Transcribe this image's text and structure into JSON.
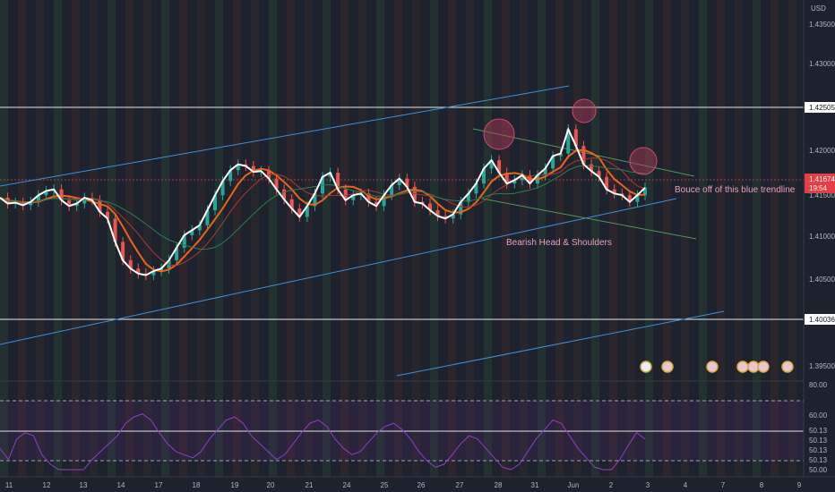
{
  "chart_data": {
    "type": "candlestick",
    "currency": "USD",
    "y_ticks": [
      "1.43500",
      "1.43000",
      "1.42000",
      "1.41500",
      "1.41000",
      "1.40500",
      "1.39500"
    ],
    "ylim": [
      1.395,
      1.436
    ],
    "x_ticks": [
      "11",
      "12",
      "13",
      "14",
      "17",
      "18",
      "19",
      "20",
      "21",
      "24",
      "25",
      "26",
      "27",
      "28",
      "31",
      "Jun",
      "2",
      "3",
      "4",
      "7",
      "8",
      "9"
    ],
    "price_labels": {
      "upper_level": "1.42505",
      "lower_level": "1.40036",
      "current_price": "1.41674",
      "countdown": "19:54"
    },
    "annotations": {
      "trendline_note": "Bouce off of this blue trendline",
      "pattern_note": "Bearish Head & Shoulders"
    },
    "close_path": [
      1.4155,
      1.4148,
      1.4149,
      1.4146,
      1.415,
      1.4158,
      1.4163,
      1.4165,
      1.4152,
      1.4145,
      1.4148,
      1.4155,
      1.4152,
      1.4138,
      1.413,
      1.4102,
      1.408,
      1.407,
      1.4064,
      1.4062,
      1.4067,
      1.407,
      1.408,
      1.4095,
      1.411,
      1.4116,
      1.4122,
      1.414,
      1.4158,
      1.4175,
      1.4188,
      1.4195,
      1.4193,
      1.4186,
      1.4187,
      1.4178,
      1.4165,
      1.4153,
      1.4142,
      1.4132,
      1.4145,
      1.416,
      1.418,
      1.4185,
      1.4165,
      1.4152,
      1.4158,
      1.416,
      1.415,
      1.4145,
      1.4158,
      1.417,
      1.4178,
      1.4168,
      1.415,
      1.4148,
      1.414,
      1.4133,
      1.413,
      1.4135,
      1.415,
      1.416,
      1.4172,
      1.419,
      1.42,
      1.4185,
      1.4172,
      1.4176,
      1.4182,
      1.4172,
      1.4182,
      1.419,
      1.4205,
      1.4208,
      1.4237,
      1.4217,
      1.4195,
      1.4187,
      1.418,
      1.4165,
      1.416,
      1.4158,
      1.415,
      1.4158,
      1.4167
    ],
    "rsi": {
      "levels": [
        "80.00",
        "60.00",
        "50.13",
        "50.13",
        "50.13",
        "50.13",
        "50.00"
      ],
      "ylim": [
        50,
        80
      ],
      "values": [
        52,
        45,
        58,
        62,
        60,
        48,
        42,
        35,
        30,
        32,
        38,
        45,
        50,
        55,
        60,
        68,
        72,
        74,
        70,
        62,
        55,
        50,
        48,
        46,
        50,
        58,
        64,
        70,
        72,
        68,
        60,
        55,
        50,
        45,
        48,
        55,
        62,
        68,
        70,
        66,
        58,
        52,
        48,
        50,
        56,
        62,
        66,
        68,
        64,
        58,
        50,
        44,
        40,
        42,
        48,
        55,
        60,
        58,
        52,
        46,
        40,
        38,
        42,
        50,
        58,
        64,
        70,
        68,
        60,
        52,
        46,
        40,
        36,
        38,
        45,
        54,
        62,
        58
      ]
    }
  }
}
